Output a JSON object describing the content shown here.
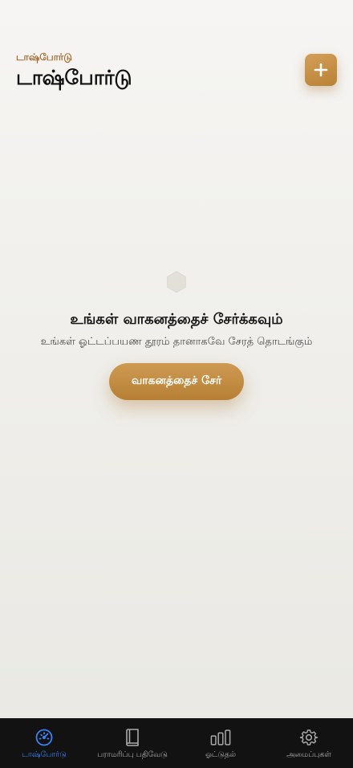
{
  "header": {
    "eyebrow": "டாஷ்போர்டு",
    "title": "டாஷ்போர்டு",
    "add_button_icon": "plus-icon"
  },
  "empty_state": {
    "icon": "hexagon-icon",
    "title": "உங்கள் வாகனத்தைச் சேர்க்கவும்",
    "description": "உங்கள் ஓட்டப்பயண தூரம் தானாகவே சேரத் தொடங்கும்",
    "button_label": "வாகனத்தைச் சேர்"
  },
  "bottom_nav": {
    "items": [
      {
        "label": "டாஷ்போர்டு",
        "icon": "speedometer-icon",
        "active": true
      },
      {
        "label": "பராமரிப்பு பதிவேடு",
        "icon": "book-icon",
        "active": false
      },
      {
        "label": "ஓட்டுதல்",
        "icon": "bar-chart-icon",
        "active": false
      },
      {
        "label": "அமைப்புகள்",
        "icon": "gear-icon",
        "active": false
      }
    ]
  },
  "colors": {
    "accent": "#c48d45",
    "accent_text": "#a46a2c",
    "nav_active": "#3b82f6",
    "nav_inactive": "#a9a9a9",
    "nav_background": "#121212"
  }
}
